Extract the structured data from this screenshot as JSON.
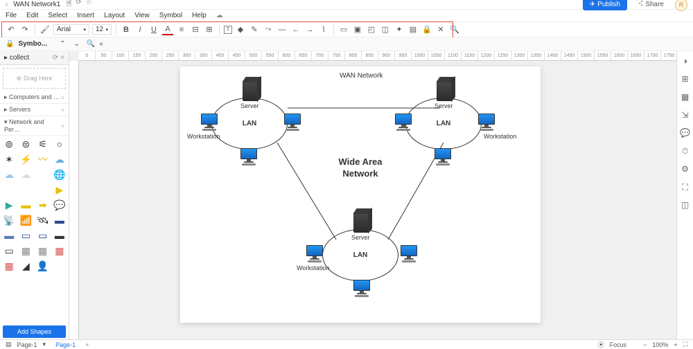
{
  "titlebar": {
    "docname": "WAN Network1",
    "publish": "Publish",
    "share": "Share",
    "avatar": "R"
  },
  "menubar": [
    "File",
    "Edit",
    "Select",
    "Insert",
    "Layout",
    "View",
    "Symbol",
    "Help"
  ],
  "toolbar": {
    "font": "Arial",
    "size": "12"
  },
  "symbolbar": {
    "label": "Symbo..."
  },
  "sidebar": {
    "tab": "collect",
    "drop": "Drag Here",
    "sections": [
      "Computers and …",
      "Servers",
      "Network and Per…"
    ],
    "add": "Add Shapes"
  },
  "statusbar": {
    "page_label": "Page-1",
    "page_tab": "Page-1",
    "focus": "Focus",
    "zoom": "100%"
  },
  "diagram": {
    "title": "WAN Network",
    "center": "Wide Area\nNetwork",
    "lan": "LAN",
    "server": "Server",
    "workstation": "Workstation"
  },
  "ruler_vals": [
    "0",
    "50",
    "100",
    "150",
    "200",
    "250",
    "300",
    "350",
    "400",
    "450",
    "500",
    "550",
    "600",
    "650",
    "700",
    "750",
    "800",
    "850",
    "900",
    "950",
    "1000",
    "1050",
    "1100",
    "1150",
    "1200",
    "1250",
    "1300",
    "1350",
    "1400",
    "1450",
    "1500",
    "1550",
    "1600",
    "1650",
    "1700",
    "1750"
  ]
}
